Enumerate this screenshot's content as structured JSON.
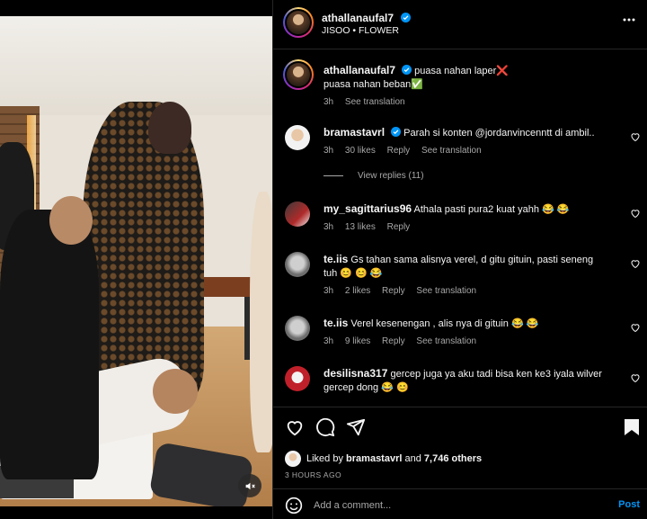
{
  "post": {
    "username": "athallanaufal7",
    "music": "JISOO • FLOWER",
    "caption_line1": "puasa nahan laper❌",
    "caption_line2": "puasa nahan beban✅",
    "caption_time": "3h",
    "see_translation": "See translation"
  },
  "comments": [
    {
      "username": "bramastavrl",
      "verified": true,
      "text": "Parah si konten @jordanvincenntt di ambil..",
      "time": "3h",
      "likes": "30 likes",
      "reply": "Reply",
      "translation": "See translation",
      "view_replies": "View replies (11)"
    },
    {
      "username": "my_sagittarius96",
      "text": "Athala pasti pura2 kuat yahh 😂 😂",
      "time": "3h",
      "likes": "13 likes",
      "reply": "Reply"
    },
    {
      "username": "te.iis",
      "text_line1": "Gs tahan sama alisnya verel, d gitu gituin, pasti seneng",
      "text_line2": "tuh 😊 😊 😂",
      "time": "3h",
      "likes": "2 likes",
      "reply": "Reply",
      "translation": "See translation"
    },
    {
      "username": "te.iis",
      "text": "Verel kesenengan , alis nya di gituin 😂 😂",
      "time": "3h",
      "likes": "9 likes",
      "reply": "Reply",
      "translation": "See translation"
    },
    {
      "username": "desilisna317",
      "text_line1": "gercep juga ya aku tadi bisa ken ke3 iyala wilver",
      "text_line2": "gercep dong 😂 😊"
    }
  ],
  "actions": {
    "liked_by_prefix": "Liked by",
    "liked_by_user": "bramastavrl",
    "liked_by_and": "and",
    "others": "7,746 others",
    "timestamp": "3 HOURS AGO"
  },
  "footer": {
    "placeholder": "Add a comment...",
    "post_label": "Post"
  },
  "colors": {
    "verified": "#0095f6",
    "post_button": "#0095f6",
    "secondary_text": "#a8a8a8"
  }
}
